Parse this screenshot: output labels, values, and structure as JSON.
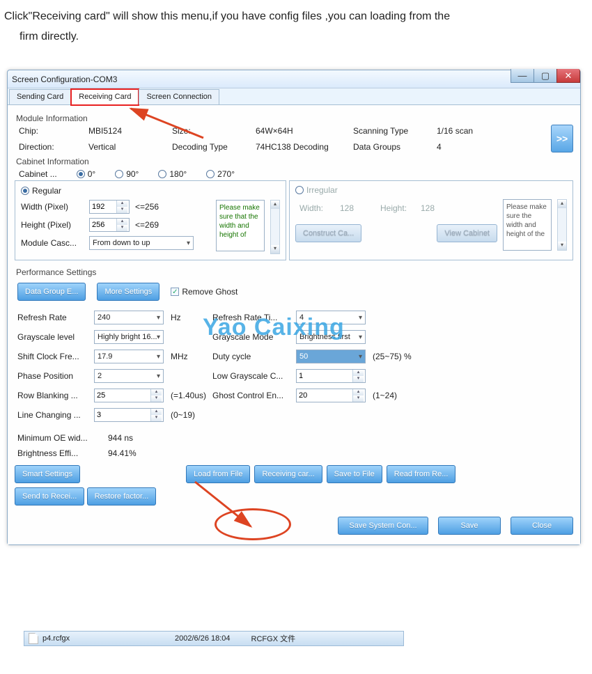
{
  "caption_line1": "Click\"Receiving card\" will show this menu,if you have config files ,you can loading from the",
  "caption_line2": "firm directly.",
  "window_title": "Screen Configuration-COM3",
  "tabs": {
    "sending": "Sending Card",
    "receiving": "Receiving Card",
    "connection": "Screen Connection"
  },
  "module_info": {
    "heading": "Module Information",
    "chip_l": "Chip:",
    "chip_v": "MBI5124",
    "size_l": "Size:",
    "size_v": "64W×64H",
    "scan_l": "Scanning Type",
    "scan_v": "1/16 scan",
    "dir_l": "Direction:",
    "dir_v": "Vertical",
    "dec_l": "Decoding Type",
    "dec_v": "74HC138 Decoding",
    "dg_l": "Data Groups",
    "dg_v": "4",
    "expand": ">>"
  },
  "cabinet": {
    "heading": "Cabinet Information",
    "rot_label": "Cabinet ...",
    "rot0": "0°",
    "rot90": "90°",
    "rot180": "180°",
    "rot270": "270°",
    "regular": "Regular",
    "irregular": "Irregular",
    "width_l": "Width (Pixel)",
    "width_v": "192",
    "width_hint": "<=256",
    "height_l": "Height (Pixel)",
    "height_v": "256",
    "height_hint": "<=269",
    "casc_l": "Module Casc...",
    "casc_v": "From down to up",
    "note_reg": "Please make sure that the width and height of",
    "irr_width_l": "Width:",
    "irr_width_v": "128",
    "irr_height_l": "Height:",
    "irr_height_v": "128",
    "construct": "Construct Ca...",
    "view": "View Cabinet",
    "note_irr": "Please make sure the width and height of the"
  },
  "perf": {
    "heading": "Performance Settings",
    "btn_dge": "Data Group E...",
    "btn_more": "More Settings",
    "chk_ghost": "Remove Ghost",
    "rr_l": "Refresh Rate",
    "rr_v": "240",
    "hz": "Hz",
    "rrt_l": "Refresh Rate Ti...",
    "rrt_v": "4",
    "gl_l": "Grayscale level",
    "gl_v": "Highly bright 16...",
    "gm_l": "Grayscale Mode",
    "gm_v": "Brightness first",
    "scf_l": "Shift Clock Fre...",
    "scf_v": "17.9",
    "mhz": "MHz",
    "duty_l": "Duty cycle",
    "duty_v": "50",
    "duty_h": "(25~75) %",
    "pp_l": "Phase Position",
    "pp_v": "2",
    "lgc_l": "Low Grayscale C...",
    "lgc_v": "1",
    "rb_l": "Row Blanking ...",
    "rb_v": "25",
    "rb_h": "(=1.40us)",
    "gce_l": "Ghost Control En...",
    "gce_v": "20",
    "gce_h": "(1~24)",
    "lc_l": "Line Changing ...",
    "lc_v": "3",
    "lc_h": "(0~19)",
    "min_oe_l": "Minimum OE wid...",
    "min_oe_v": "944 ns",
    "beff_l": "Brightness Effi...",
    "beff_v": "94.41%"
  },
  "buttons": {
    "smart": "Smart Settings",
    "load": "Load from File",
    "recv": "Receiving car...",
    "savef": "Save to File",
    "readr": "Read from Re...",
    "sendr": "Send to Recei...",
    "restore": "Restore factor...",
    "savesys": "Save System Con...",
    "save": "Save",
    "close": "Close"
  },
  "watermark": "Yao Caixing",
  "file": {
    "name": "p4.rcfgx",
    "date": "2002/6/26 18:04",
    "type": "RCFGX 文件"
  }
}
